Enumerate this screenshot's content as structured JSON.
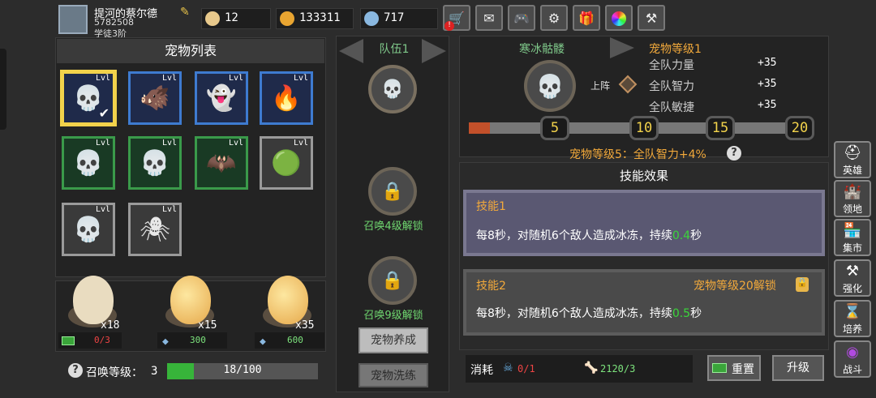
{
  "player": {
    "name": "提河的蔡尔德",
    "id": "5782508",
    "rank": "学徒3阶"
  },
  "resources": [
    {
      "icon": "egg-icon",
      "value": "12"
    },
    {
      "icon": "gold-coin-icon",
      "value": "133311"
    },
    {
      "icon": "gem-icon",
      "value": "717"
    }
  ],
  "top_buttons": [
    "shop-cart-icon",
    "mail-icon",
    "gamepad-icon",
    "gear-icon",
    "gift-icon",
    "color-wheel-icon",
    "tools-icon"
  ],
  "pet_list": {
    "title": "宠物列表",
    "pets": [
      {
        "lv": "Lvl",
        "glyph": "💀"
      },
      {
        "lv": "Lvl",
        "glyph": "🐗"
      },
      {
        "lv": "Lvl",
        "glyph": "👻"
      },
      {
        "lv": "Lvl",
        "glyph": "🔥"
      },
      {
        "lv": "Lvl",
        "glyph": "💀"
      },
      {
        "lv": "Lvl",
        "glyph": "💀"
      },
      {
        "lv": "Lvl",
        "glyph": "🦇"
      },
      {
        "lv": "Lvl",
        "glyph": "🟢"
      },
      {
        "lv": "Lvl",
        "glyph": "💀"
      },
      {
        "lv": "Lvl",
        "glyph": "🕷"
      }
    ],
    "selected_check": "✔"
  },
  "eggs": [
    {
      "count": "x18",
      "cost": "0/3",
      "cost_icon": "video-ad-icon"
    },
    {
      "count": "x15",
      "cost": "300",
      "cost_icon": "diamond-icon"
    },
    {
      "count": "x35",
      "cost": "600",
      "cost_icon": "diamond-icon"
    }
  ],
  "summon": {
    "label": "召唤等级：",
    "level": "3",
    "progress_text": "18/100",
    "progress": 0.18,
    "help": "?"
  },
  "team": {
    "title": "队伍1",
    "slot1_glyph": "💀",
    "unlock2": "召唤4级解锁",
    "unlock3": "召唤9级解锁",
    "btn_raise": "宠物养成",
    "btn_wash": "宠物洗练"
  },
  "detail": {
    "pet_name": "寒冰骷髅",
    "pet_glyph": "💀",
    "deploy_label": "上阵",
    "level_title": "宠物等级1",
    "stats": [
      {
        "name": "全队力量",
        "value": "+35"
      },
      {
        "name": "全队智力",
        "value": "+35"
      },
      {
        "name": "全队敏捷",
        "value": "+35"
      }
    ],
    "milestones": [
      "5",
      "10",
      "15",
      "20"
    ],
    "level_progress": 0.06,
    "bonus": "宠物等级5：全队智力+4%",
    "bonus_help": "?",
    "skills_title": "技能效果",
    "skill1": {
      "name": "技能1",
      "desc_prefix": "每8秒，对随机6个敌人造成冰冻，持续",
      "duration": "0.4",
      "desc_suffix": "秒"
    },
    "skill2": {
      "name": "技能2",
      "lock_text": "宠物等级20解锁",
      "desc_prefix": "每8秒，对随机6个敌人造成冰冻，持续",
      "duration": "0.5",
      "desc_suffix": "秒"
    },
    "cost_label": "消耗",
    "cost1": "0/1",
    "cost2": "2120/3",
    "reset_label": "重置",
    "upgrade_label": "升级"
  },
  "side_menu": [
    {
      "label": "英雄",
      "icon": "helmet-icon"
    },
    {
      "label": "领地",
      "icon": "castle-icon"
    },
    {
      "label": "集市",
      "icon": "market-icon"
    },
    {
      "label": "强化",
      "icon": "anvil-icon"
    },
    {
      "label": "培养",
      "icon": "hourglass-icon"
    },
    {
      "label": "战斗",
      "icon": "portal-icon"
    }
  ]
}
